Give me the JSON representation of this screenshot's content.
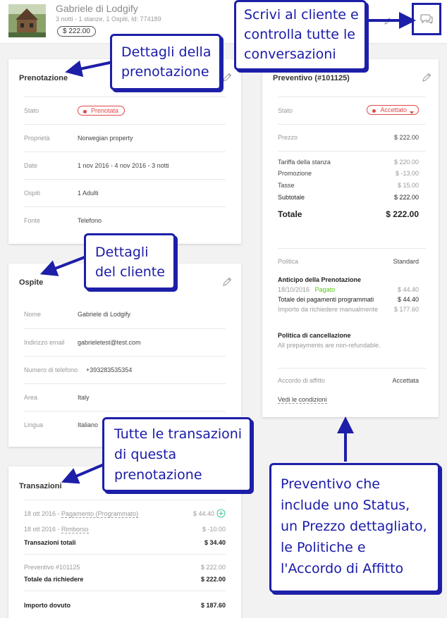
{
  "header": {
    "guest_name": "Gabriele di Lodgify",
    "meta": "3 notti - 1 stanze, 1 Ospiti, Id: 774189",
    "price": "$ 222.00"
  },
  "booking": {
    "title": "Prenotazione",
    "status_label": "Stato",
    "status_value": "Prenotata",
    "rows": [
      {
        "label": "Proprietà",
        "value": "Norwegian property"
      },
      {
        "label": "Date",
        "value": "1 nov 2016 - 4 nov 2016 - 3 notti"
      },
      {
        "label": "Ospiti",
        "value": "1 Adulti"
      },
      {
        "label": "Fonte",
        "value": "Telefono"
      }
    ]
  },
  "guest": {
    "title": "Ospite",
    "rows": [
      {
        "label": "Nome",
        "value": "Gabriele di Lodgify"
      },
      {
        "label": "Indirizzo email",
        "value": "gabrieletest@test.com"
      },
      {
        "label": "Numero di telefono",
        "value": "+393283535354"
      },
      {
        "label": "Area",
        "value": "Italy"
      },
      {
        "label": "Lingua",
        "value": "Italiano"
      }
    ]
  },
  "transactions": {
    "title": "Transazioni",
    "lines": [
      {
        "label": "18 ott 2016 - ",
        "link": "Pagamento (Programmato)",
        "value": "$ 44.40"
      },
      {
        "label": "18 ott 2016 - ",
        "link": "Rimborso",
        "value": "$ -10.00"
      }
    ],
    "total_label": "Transazioni totali",
    "total_value": "$ 34.40",
    "quote_label": "Preventivo #101125",
    "quote_value": "$ 222.00",
    "to_request_label": "Totale da richiedere",
    "to_request_value": "$ 222.00",
    "due_label": "Importo dovuto",
    "due_value": "$ 187.60"
  },
  "quote": {
    "title": "Preventivo (#101125)",
    "status_label": "Stato",
    "status_value": "Accettato",
    "price_label": "Prezzo",
    "price_value": "$ 222.00",
    "breakdown": [
      {
        "label": "Tariffa della stanza",
        "value": "$ 220.00"
      },
      {
        "label": "Promozione",
        "value": "$ -13.00"
      },
      {
        "label": "Tasse",
        "value": "$ 15.00"
      },
      {
        "label": "Subtotale",
        "value": "$ 222.00"
      }
    ],
    "total_label": "Totale",
    "total_value": "$ 222.00",
    "policy_label": "Politica",
    "policy_value": "Standard",
    "deposit_title": "Anticipo della Prenotazione",
    "deposit_date": "18/10/2016",
    "deposit_status": "Pagato",
    "deposit_value": "$ 44.40",
    "scheduled_label": "Totale dei pagamenti programmati",
    "scheduled_value": "$ 44.40",
    "manual_label": "Importo da richiedere manualmente",
    "manual_value": "$ 177.60",
    "cancel_title": "Politica di cancellazione",
    "cancel_text": "All prepayments are non-refundable.",
    "agreement_label": "Accordo di affitto",
    "agreement_value": "Accettata",
    "terms_link": "Vedi le condizioni"
  },
  "annotations": {
    "chat": [
      "Scrivi al cliente e",
      "controlla tutte le",
      "conversazioni"
    ],
    "booking": [
      "Dettagli della",
      "prenotazione"
    ],
    "guest": [
      "Dettagli",
      "del cliente"
    ],
    "transactions": [
      "Tutte le transazioni",
      "di questa",
      "prenotazione"
    ],
    "quote": [
      "Preventivo che",
      "include uno Status,",
      "un Prezzo dettagliato,",
      "le Politiche e",
      "l'Accordo di Affitto"
    ]
  },
  "colors": {
    "annotation_blue": "#1d1fa8",
    "status_red": "#e04848",
    "paid_green": "#5cc41a"
  }
}
